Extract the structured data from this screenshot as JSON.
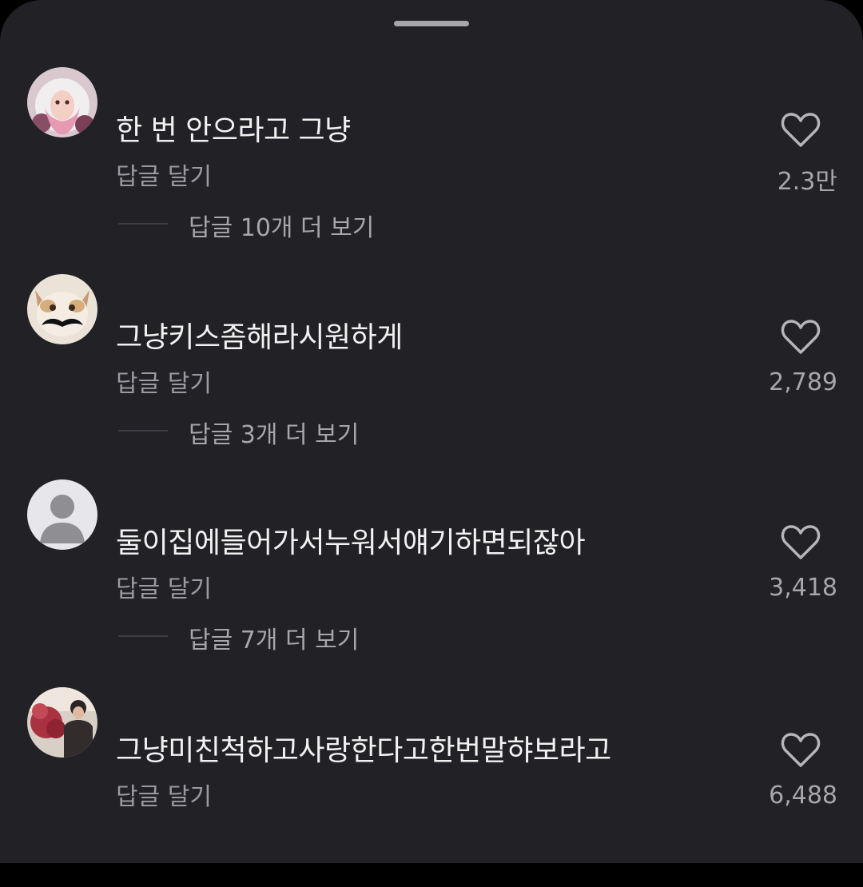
{
  "comments": [
    {
      "text": "한 번 안으라고 그냥",
      "reply_label": "답글 달기",
      "view_replies": "답글 10개 더 보기",
      "likes": "2.3만",
      "avatar": "profile-photo-pink-hood"
    },
    {
      "text": "그냥키스좀해라시원하게",
      "reply_label": "답글 달기",
      "view_replies": "답글 3개 더 보기",
      "likes": "2,789",
      "avatar": "profile-photo-cat-mustache"
    },
    {
      "text": "둘이집에들어가서누워서얘기하면되잖아",
      "reply_label": "답글 달기",
      "view_replies": "답글 7개 더 보기",
      "likes": "3,418",
      "avatar": "default-user-icon"
    },
    {
      "text": "그냥미친척하고사랑한다고한번말햐보라고",
      "reply_label": "답글 달기",
      "likes": "6,488",
      "avatar": "profile-photo-flowers"
    }
  ],
  "icons": {
    "like": "heart-outline-icon",
    "grabber": "drag-handle"
  },
  "colors": {
    "background": "#212126",
    "primary_text": "#f2f2f2",
    "secondary_text": "#9a9aa0"
  }
}
